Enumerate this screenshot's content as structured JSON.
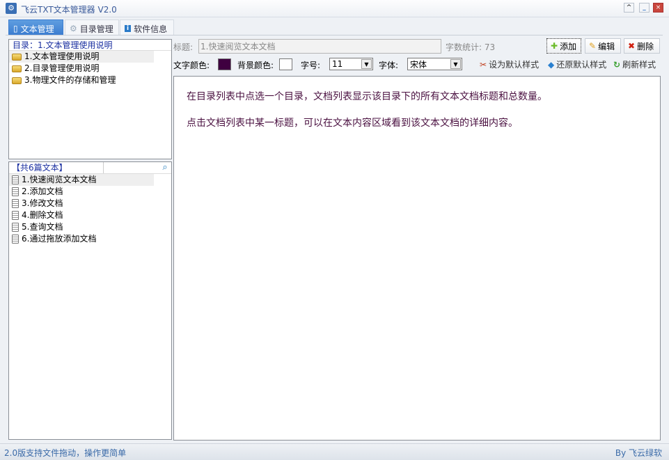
{
  "app": {
    "title": "飞云TXT文本管理器 V2.0"
  },
  "window": {
    "restore": "^",
    "minimize": "_",
    "close": "×"
  },
  "tabs": [
    {
      "label": "文本管理"
    },
    {
      "label": "目录管理"
    },
    {
      "label": "软件信息"
    }
  ],
  "directory": {
    "header": "目录：1.文本管理使用说明",
    "items": [
      "1.文本管理使用说明",
      "2.目录管理使用说明",
      "3.物理文件的存储和管理"
    ]
  },
  "documents": {
    "count_label": "【共6篇文本】",
    "search_value": "",
    "items": [
      "1.快速阅览文本文档",
      "2.添加文档",
      "3.修改文档",
      "4.删除文档",
      "5.查询文档",
      "6.通过拖放添加文档"
    ]
  },
  "editor": {
    "title_label": "标题:",
    "title_value": "1.快速阅览文本文档",
    "word_count": "字数统计: 73",
    "add": "添加",
    "edit": "编辑",
    "delete": "删除",
    "text_color_label": "文字颜色:",
    "text_color": "#3f0040",
    "bg_color_label": "背景颜色:",
    "bg_color": "#ffffff",
    "size_label": "字号:",
    "size_value": "11",
    "font_label": "字体:",
    "font_value": "宋体",
    "set_default": "设为默认样式",
    "restore_default": "还原默认样式",
    "refresh": "刷新样式",
    "content": [
      "在目录列表中点选一个目录，文档列表显示该目录下的所有文本文档标题和总数量。",
      "点击文档列表中某一标题，可以在文本内容区域看到该文本文档的详细内容。"
    ]
  },
  "status": {
    "left": "2.0版支持文件拖动，操作更简单",
    "right": "By 飞云绿软"
  }
}
